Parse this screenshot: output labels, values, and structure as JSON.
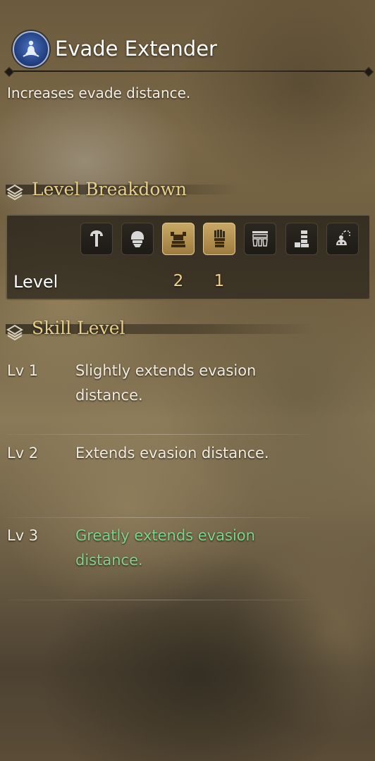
{
  "skill": {
    "name": "Evade Extender",
    "description": "Increases evade distance.",
    "emblem_icon": "meditating-figure-icon",
    "emblem_color": "#2b4f9e"
  },
  "level_breakdown": {
    "title": "Level Breakdown",
    "row_label": "Level",
    "slots": [
      {
        "icon": "weapon-icon",
        "active": false,
        "level": ""
      },
      {
        "icon": "helm-icon",
        "active": false,
        "level": ""
      },
      {
        "icon": "chest-icon",
        "active": true,
        "level": "2"
      },
      {
        "icon": "arms-icon",
        "active": true,
        "level": "1"
      },
      {
        "icon": "waist-icon",
        "active": false,
        "level": ""
      },
      {
        "icon": "legs-icon",
        "active": false,
        "level": ""
      },
      {
        "icon": "talisman-icon",
        "active": false,
        "level": ""
      }
    ],
    "active_color": "#b8955a"
  },
  "skill_level": {
    "title": "Skill Level",
    "levels": [
      {
        "label": "Lv 1",
        "line1": "Slightly extends evasion",
        "line2": "distance.",
        "current": false
      },
      {
        "label": "Lv 2",
        "line1": "Extends evasion distance.",
        "line2": "",
        "current": false
      },
      {
        "label": "Lv 3",
        "line1": "Greatly extends evasion",
        "line2": "distance.",
        "current": true
      }
    ],
    "current_color": "#7fd38a"
  }
}
